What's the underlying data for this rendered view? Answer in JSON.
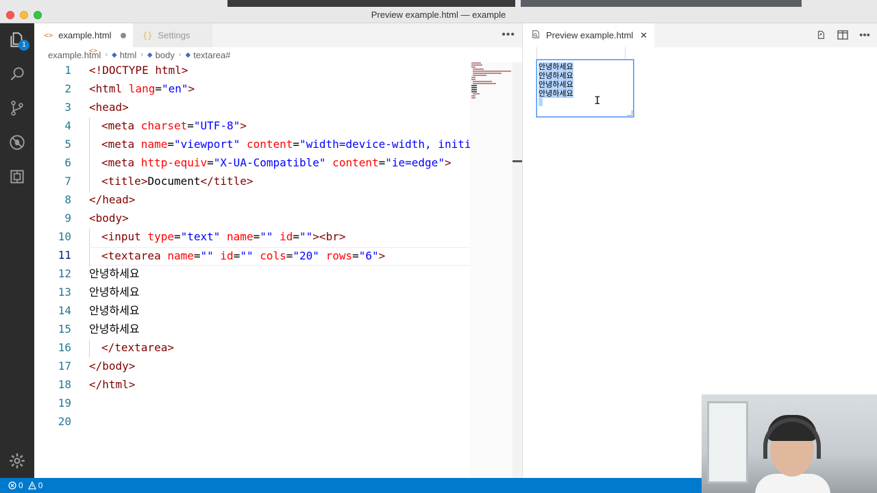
{
  "window": {
    "title": "Preview example.html — example"
  },
  "activity_bar": {
    "explorer_badge": "1"
  },
  "editor_tabs": [
    {
      "label": "example.html"
    },
    {
      "label": "Settings"
    }
  ],
  "breadcrumb": [
    "example.html",
    "html",
    "body",
    "textarea#"
  ],
  "line_numbers": [
    "1",
    "2",
    "3",
    "4",
    "5",
    "6",
    "7",
    "8",
    "9",
    "10",
    "11",
    "12",
    "13",
    "14",
    "15",
    "16",
    "17",
    "18",
    "19",
    "20"
  ],
  "code": {
    "l1": {
      "open": "<!DOCTYPE",
      "rest": " html>"
    },
    "l2": {
      "open": "<html",
      "attr1": " lang",
      "eq": "=",
      "val1": "\"en\"",
      "close": ">"
    },
    "l3": {
      "tag": "<head>"
    },
    "l4": {
      "open": "<meta",
      "attr1": " charset",
      "eq": "=",
      "val1": "\"UTF-8\"",
      "close": ">"
    },
    "l5": {
      "open": "<meta",
      "attr1": " name",
      "eq1": "=",
      "val1": "\"viewport\"",
      "attr2": " content",
      "eq2": "=",
      "val2": "\"width=device-width, initial-s"
    },
    "l6": {
      "open": "<meta",
      "attr1": " http-equiv",
      "eq1": "=",
      "val1": "\"X-UA-Compatible\"",
      "attr2": " content",
      "eq2": "=",
      "val2": "\"ie=edge\"",
      "close": ">"
    },
    "l7": {
      "open": "<title>",
      "text": "Document",
      "close": "</title>"
    },
    "l8": {
      "tag": "</head>"
    },
    "l9": {
      "tag": "<body>"
    },
    "l10": {
      "open": "<input",
      "attr1": " type",
      "eq1": "=",
      "val1": "\"text\"",
      "attr2": " name",
      "eq2": "=",
      "val2": "\"\"",
      "attr3": " id",
      "eq3": "=",
      "val3": "\"\"",
      "close": "><br>"
    },
    "l11": {
      "open": "<textarea",
      "attr1": " name",
      "eq1": "=",
      "val1": "\"\"",
      "attr2": " id",
      "eq2": "=",
      "val2": "\"\"",
      "attr3": " cols",
      "eq3": "=",
      "val3": "\"20\"",
      "attr4": " rows",
      "eq4": "=",
      "val4": "\"6\"",
      "close": ">"
    },
    "l12": {
      "text": "안녕하세요"
    },
    "l13": {
      "text": "안녕하세요"
    },
    "l14": {
      "text": "안녕하세요"
    },
    "l15": {
      "text": "안녕하세요"
    },
    "l16": {
      "tag": "</textarea>"
    },
    "l17": {
      "tag": "</body>"
    },
    "l18": {
      "tag": "</html>"
    }
  },
  "preview_tab": {
    "label": "Preview example.html"
  },
  "preview": {
    "textarea_lines": [
      "안녕하세요",
      "안녕하세요",
      "안녕하세요",
      "안녕하세요"
    ]
  },
  "status_bar": {
    "errors": "0",
    "warnings": "0"
  },
  "colors": {
    "status_bar": "#007acc",
    "tag": "#800000",
    "attribute": "#ff0000",
    "string": "#0000ff",
    "line_number": "#237893"
  }
}
